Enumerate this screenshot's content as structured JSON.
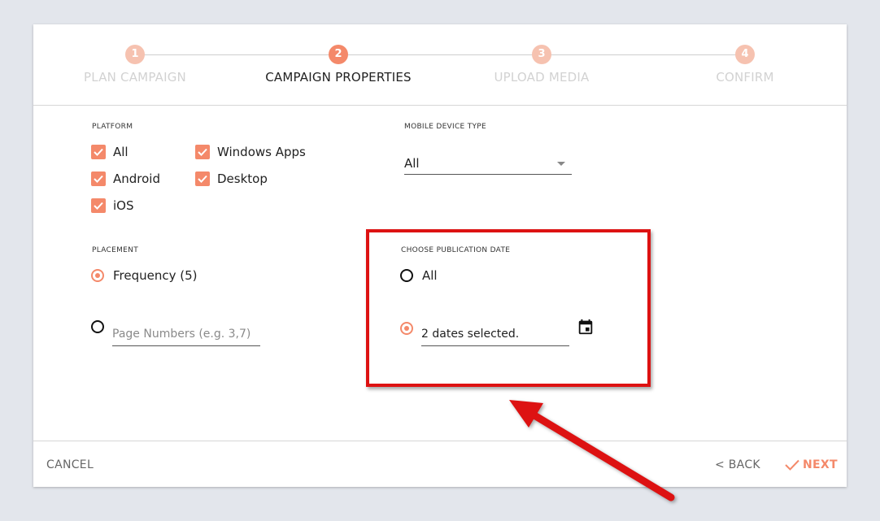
{
  "stepper": {
    "steps": [
      {
        "num": "1",
        "label": "PLAN CAMPAIGN"
      },
      {
        "num": "2",
        "label": "CAMPAIGN PROPERTIES"
      },
      {
        "num": "3",
        "label": "UPLOAD MEDIA"
      },
      {
        "num": "4",
        "label": "CONFIRM"
      }
    ]
  },
  "platform": {
    "label": "PLATFORM",
    "options": [
      "All",
      "Windows Apps",
      "Android",
      "Desktop",
      "iOS"
    ]
  },
  "mobile_device": {
    "label": "MOBILE DEVICE TYPE",
    "value": "All"
  },
  "placement": {
    "label": "PLACEMENT",
    "frequency_label": "Frequency (5)",
    "page_numbers_placeholder": "Page Numbers (e.g. 3,7)"
  },
  "publication_date": {
    "label": "CHOOSE PUBLICATION DATE",
    "all_label": "All",
    "dates_value": "2 dates selected."
  },
  "footer": {
    "cancel": "CANCEL",
    "back": "< BACK",
    "next": "NEXT"
  },
  "colors": {
    "accent": "#f4896a",
    "accent_light": "#f6c2b0",
    "annotation": "#dd1212"
  }
}
